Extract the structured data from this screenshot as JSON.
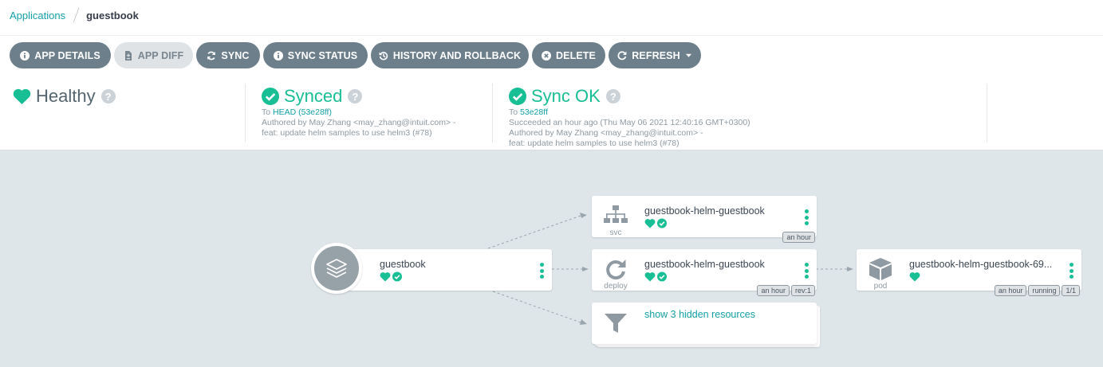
{
  "breadcrumb": {
    "parent": "Applications",
    "current": "guestbook"
  },
  "toolbar": {
    "buttons": [
      {
        "label": "APP DETAILS",
        "icon": "info-circle-icon"
      },
      {
        "label": "APP DIFF",
        "icon": "file-diff-icon",
        "disabled": true
      },
      {
        "label": "SYNC",
        "icon": "sync-icon"
      },
      {
        "label": "SYNC STATUS",
        "icon": "info-circle-icon"
      },
      {
        "label": "HISTORY AND ROLLBACK",
        "icon": "history-icon"
      },
      {
        "label": "DELETE",
        "icon": "times-circle-icon"
      },
      {
        "label": "REFRESH",
        "icon": "redo-icon",
        "dropdown": true
      }
    ]
  },
  "status": {
    "health": {
      "label": "Healthy",
      "icon": "heart-icon",
      "color": "#18be94"
    },
    "sync": {
      "label": "Synced",
      "to_prefix": "To",
      "revision": "HEAD (53e28ff)",
      "author_line": "Authored by May Zhang <may_zhang@intuit.com> -",
      "message": "feat: update helm samples to use helm3 (#78)"
    },
    "operation": {
      "label": "Sync OK",
      "to_prefix": "To",
      "revision": "53e28ff",
      "result_line": "Succeeded an hour ago (Thu May 06 2021 12:40:16 GMT+0300)",
      "author_line": "Authored by May Zhang <may_zhang@intuit.com> -",
      "message": "feat: update helm samples to use helm3 (#78)"
    },
    "help_glyph": "?"
  },
  "graph": {
    "app": {
      "name": "guestbook",
      "icon": "layers-icon"
    },
    "svc": {
      "name": "guestbook-helm-guestbook",
      "kind": "svc",
      "icon": "sitemap-icon",
      "tags": [
        "an hour"
      ]
    },
    "deploy": {
      "name": "guestbook-helm-guestbook",
      "kind": "deploy",
      "icon": "rotate-icon",
      "tags": [
        "an hour",
        "rev:1"
      ]
    },
    "pod": {
      "name": "guestbook-helm-guestbook-69...",
      "kind": "pod",
      "icon": "cube-icon",
      "tags": [
        "an hour",
        "running",
        "1/1"
      ]
    },
    "hidden": {
      "label": "show 3 hidden resources",
      "icon": "filter-icon"
    }
  },
  "colors": {
    "accent": "#18be94",
    "link": "#14a0a5",
    "button": "#6d7f8b",
    "graph_bg": "#dfe6ea"
  }
}
